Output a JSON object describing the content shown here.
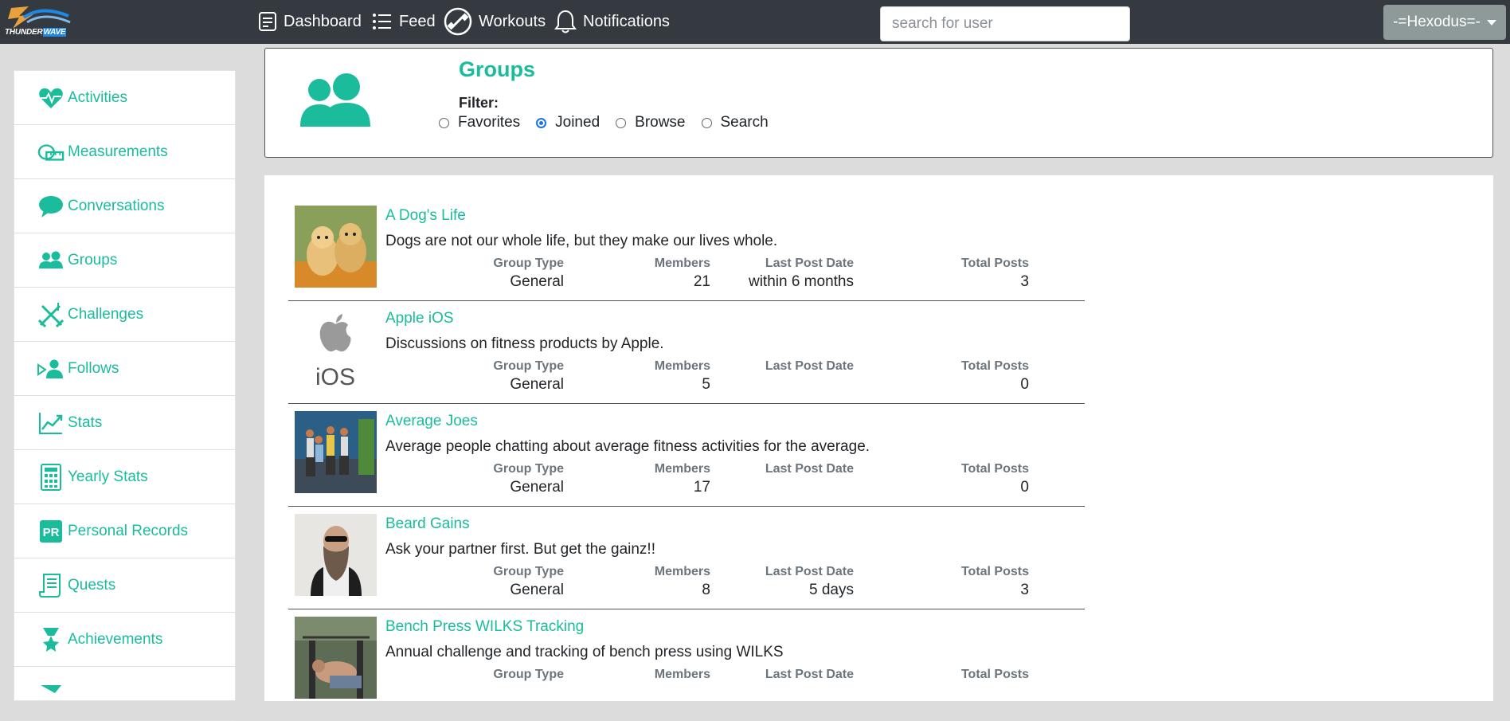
{
  "brand": {
    "name_part1": "THUNDER",
    "name_part2": "WAVE"
  },
  "nav": {
    "dashboard": "Dashboard",
    "feed": "Feed",
    "workouts": "Workouts",
    "notifications": "Notifications"
  },
  "search": {
    "placeholder": "search for user",
    "value": ""
  },
  "user": {
    "label": "-=Hexodus=-"
  },
  "sidebar": {
    "items": [
      {
        "label": "Activities",
        "icon": "heart-pulse-icon"
      },
      {
        "label": "Measurements",
        "icon": "tape-measure-icon"
      },
      {
        "label": "Conversations",
        "icon": "chat-bubble-icon"
      },
      {
        "label": "Groups",
        "icon": "users-icon"
      },
      {
        "label": "Challenges",
        "icon": "swords-icon"
      },
      {
        "label": "Follows",
        "icon": "user-follow-icon"
      },
      {
        "label": "Stats",
        "icon": "chart-line-icon"
      },
      {
        "label": "Yearly Stats",
        "icon": "calculator-icon"
      },
      {
        "label": "Personal Records",
        "icon": "pr-badge-icon"
      },
      {
        "label": "Quests",
        "icon": "scroll-icon"
      },
      {
        "label": "Achievements",
        "icon": "medal-icon"
      },
      {
        "label": "",
        "icon": "more-icon"
      }
    ]
  },
  "header": {
    "title": "Groups",
    "filter_label": "Filter:",
    "filters": [
      {
        "label": "Favorites",
        "selected": false
      },
      {
        "label": "Joined",
        "selected": true
      },
      {
        "label": "Browse",
        "selected": false
      },
      {
        "label": "Search",
        "selected": false
      }
    ]
  },
  "columns": {
    "group_type": "Group Type",
    "members": "Members",
    "last_post_date": "Last Post Date",
    "total_posts": "Total Posts"
  },
  "groups": [
    {
      "name": "A Dog's Life",
      "description": "Dogs are not our whole life, but they make our lives whole.",
      "group_type": "General",
      "members": "21",
      "last_post_date": "within 6 months",
      "total_posts": "3"
    },
    {
      "name": "Apple iOS",
      "description": "Discussions on fitness products by Apple.",
      "group_type": "General",
      "members": "5",
      "last_post_date": "",
      "total_posts": "0"
    },
    {
      "name": "Average Joes",
      "description": "Average people chatting about average fitness activities for the average.",
      "group_type": "General",
      "members": "17",
      "last_post_date": "",
      "total_posts": "0"
    },
    {
      "name": "Beard Gains",
      "description": "Ask your partner first. But get the gainz!!",
      "group_type": "General",
      "members": "8",
      "last_post_date": "5 days",
      "total_posts": "3"
    },
    {
      "name": "Bench Press WILKS Tracking",
      "description": "Annual challenge and tracking of bench press using WILKS",
      "group_type": "",
      "members": "",
      "last_post_date": "",
      "total_posts": ""
    }
  ],
  "thumb_text": {
    "ios": "iOS"
  },
  "colors": {
    "accent": "#1abc9c",
    "navbar": "#343a40",
    "user_button": "#8d9a99",
    "radio": "#1a73e8"
  }
}
